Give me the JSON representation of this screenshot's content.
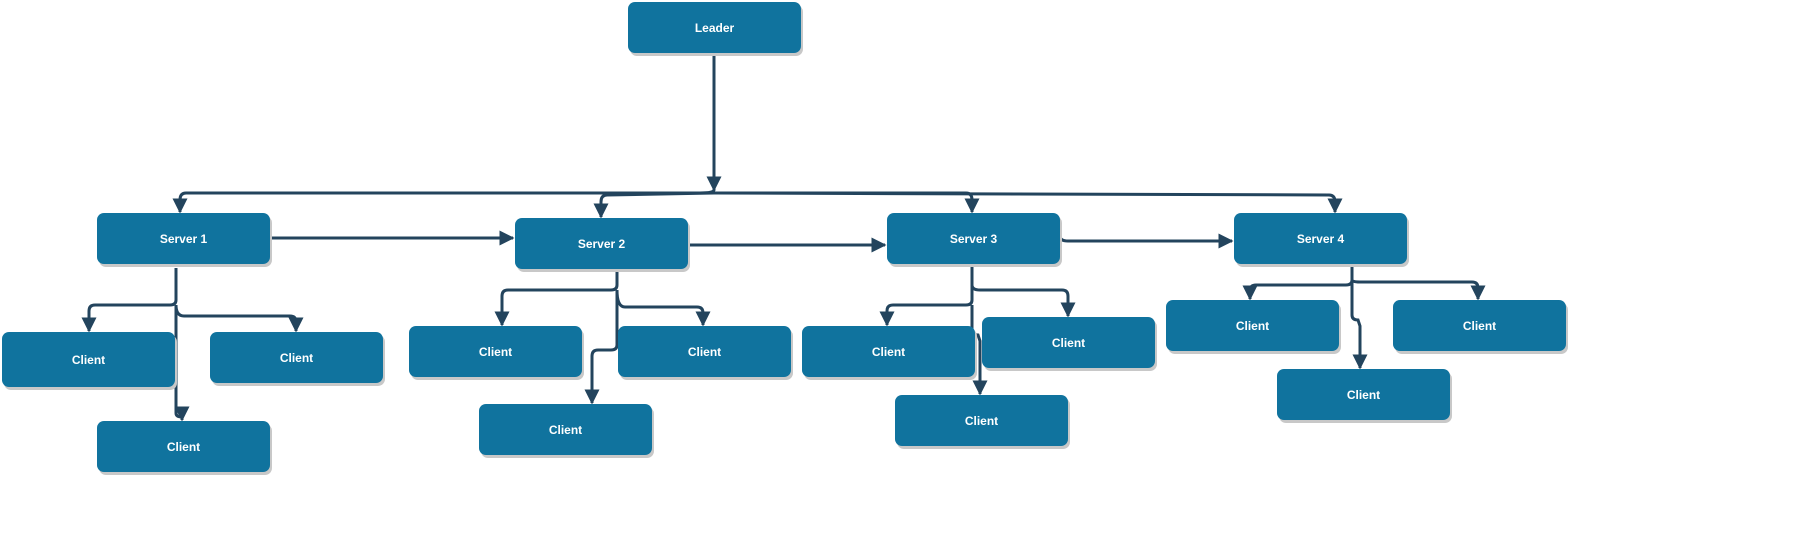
{
  "colors": {
    "node_fill": "#10739E",
    "edge": "#23445D",
    "text": "#FFFFFF"
  },
  "nodes": {
    "leader": "Leader",
    "server1": "Server 1",
    "server2": "Server 2",
    "server3": "Server 3",
    "server4": "Server 4",
    "client": "Client"
  }
}
